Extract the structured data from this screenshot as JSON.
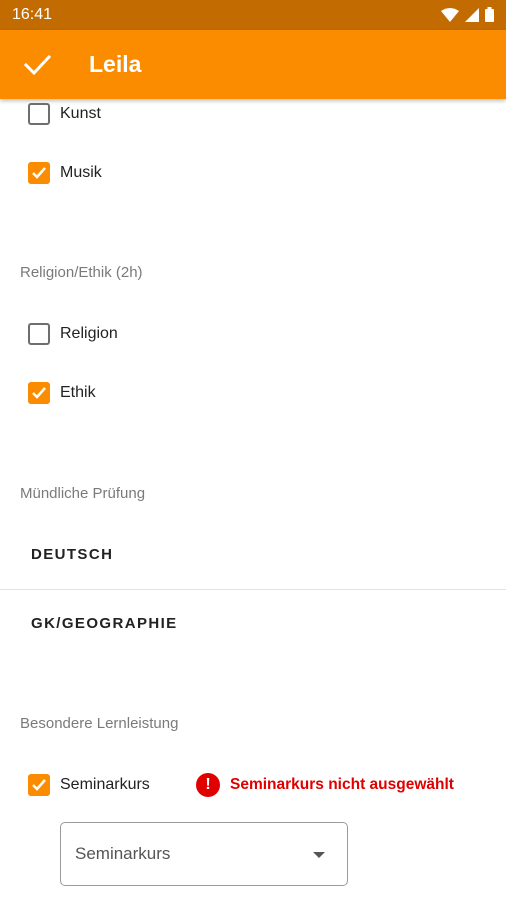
{
  "status_bar": {
    "time": "16:41",
    "icons": [
      "wifi-icon",
      "signal-icon",
      "battery-icon"
    ]
  },
  "app_bar": {
    "title": "Leila",
    "confirm_icon": "check-icon"
  },
  "colors": {
    "accent": "#fb8c00",
    "status_bar": "#c26b00",
    "error": "#e00000"
  },
  "arts": {
    "items": [
      {
        "label": "Kunst",
        "checked": false
      },
      {
        "label": "Musik",
        "checked": true
      }
    ]
  },
  "religion": {
    "title": "Religion/Ethik (2h)",
    "items": [
      {
        "label": "Religion",
        "checked": false
      },
      {
        "label": "Ethik",
        "checked": true
      }
    ]
  },
  "oral_exam": {
    "title": "Mündliche Prüfung",
    "subjects": [
      "DEUTSCH",
      "GK/GEOGRAPHIE"
    ]
  },
  "special": {
    "title": "Besondere Lernleistung",
    "checkbox": {
      "label": "Seminarkurs",
      "checked": true
    },
    "error": "Seminarkurs nicht ausgewählt",
    "dropdown": {
      "value": "Seminarkurs"
    }
  }
}
